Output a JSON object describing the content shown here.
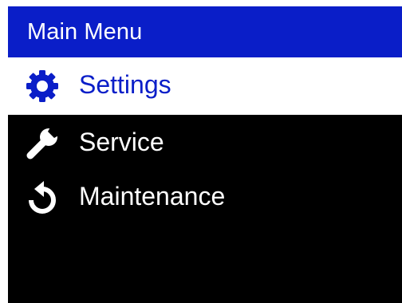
{
  "header": {
    "title": "Main Menu"
  },
  "menu": {
    "items": [
      {
        "label": "Settings",
        "icon": "gear-icon",
        "selected": true
      },
      {
        "label": "Service",
        "icon": "wrench-icon",
        "selected": false
      },
      {
        "label": "Maintenance",
        "icon": "reset-icon",
        "selected": false
      }
    ]
  },
  "colors": {
    "accent": "#0a1ec8",
    "background": "#000000",
    "selected_background": "#ffffff",
    "text": "#ffffff"
  }
}
